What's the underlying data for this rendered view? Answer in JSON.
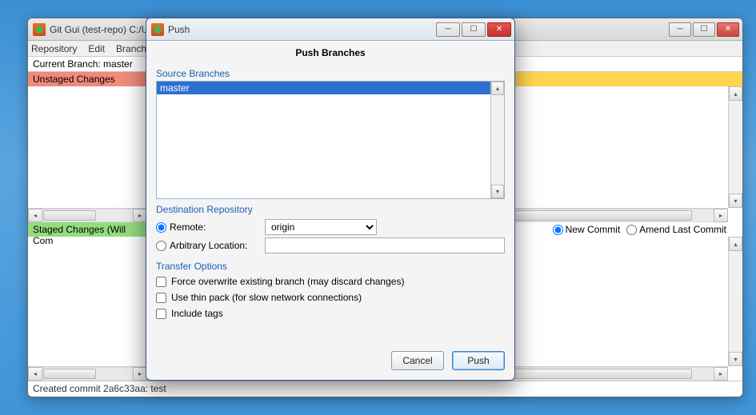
{
  "main": {
    "title": "Git Gui (test-repo) C:/U",
    "menu": {
      "repo": "Repository",
      "edit": "Edit",
      "branch": "Branch"
    },
    "current_branch_label": "Current Branch: ",
    "current_branch": "master",
    "unstaged_label": "Unstaged Changes",
    "staged_label": "Staged Changes (Will Com",
    "new_commit": "New Commit",
    "amend": "Amend Last Commit",
    "status": "Created commit 2a6c33aa: test"
  },
  "dialog": {
    "title": "Push",
    "heading": "Push Branches",
    "source_label": "Source Branches",
    "source_item": "master",
    "dest_label": "Destination Repository",
    "remote_label": "Remote:",
    "remote_value": "origin",
    "arbitrary_label": "Arbitrary Location:",
    "arbitrary_value": "",
    "transfer_label": "Transfer Options",
    "force_label": "Force overwrite existing branch (may discard changes)",
    "thin_label": "Use thin pack (for slow network connections)",
    "tags_label": "Include tags",
    "cancel": "Cancel",
    "push": "Push"
  }
}
